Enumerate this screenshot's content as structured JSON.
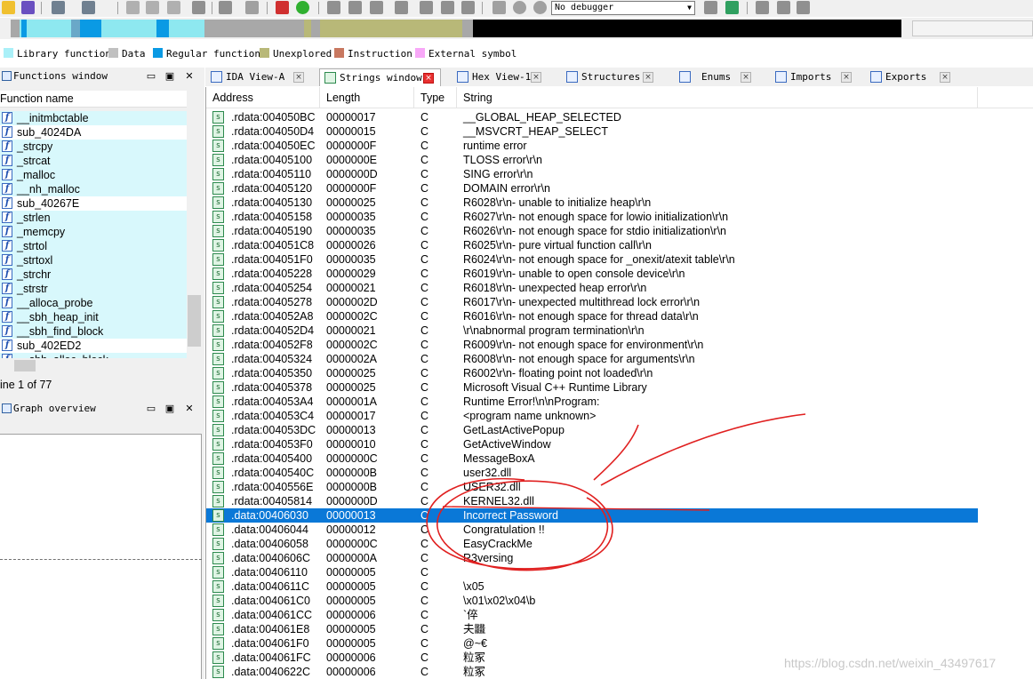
{
  "toolbar": {
    "debugger": "No debugger",
    "icons": [
      "open-icon",
      "save-icon",
      "back-icon",
      "forward-icon",
      "copy-icon",
      "paste-icon",
      "search-icon",
      "down-icon",
      "dump-icon",
      "warning-icon",
      "run-green-icon",
      "hex-icon",
      "data-icon",
      "plus-icon",
      "star-icon",
      "code-icon",
      "graph-icon",
      "cross-icon",
      "play-icon",
      "pause-icon",
      "stop-icon",
      "attach-icon",
      "detach-icon",
      "tools-icon"
    ]
  },
  "legend": {
    "items": [
      {
        "label": "Library function",
        "color": "#aaf0f8"
      },
      {
        "label": "Data",
        "color": "#c0c0c0"
      },
      {
        "label": "Regular function",
        "color": "#0a9ae4"
      },
      {
        "label": "Unexplored",
        "color": "#b8b878"
      },
      {
        "label": "Instruction",
        "color": "#c87860"
      },
      {
        "label": "External symbol",
        "color": "#f8a8f8"
      }
    ]
  },
  "functions_window": {
    "title": "Functions window",
    "column": "Function name",
    "items": [
      {
        "name": "__initmbctable",
        "lib": true
      },
      {
        "name": "sub_4024DA",
        "lib": false
      },
      {
        "name": "_strcpy",
        "lib": true
      },
      {
        "name": "_strcat",
        "lib": true
      },
      {
        "name": "_malloc",
        "lib": true
      },
      {
        "name": "__nh_malloc",
        "lib": true
      },
      {
        "name": "sub_40267E",
        "lib": false
      },
      {
        "name": "_strlen",
        "lib": true
      },
      {
        "name": "_memcpy",
        "lib": true
      },
      {
        "name": "_strtol",
        "lib": true
      },
      {
        "name": "_strtoxl",
        "lib": true
      },
      {
        "name": "_strchr",
        "lib": true
      },
      {
        "name": "_strstr",
        "lib": true
      },
      {
        "name": "__alloca_probe",
        "lib": true
      },
      {
        "name": "__sbh_heap_init",
        "lib": true
      },
      {
        "name": "__sbh_find_block",
        "lib": true
      },
      {
        "name": "sub_402ED2",
        "lib": false
      },
      {
        "name": "__sbh_alloc_block",
        "lib": true
      }
    ],
    "status": "ine 1 of 77"
  },
  "graph_overview": {
    "title": "Graph overview"
  },
  "tabs": [
    {
      "label": "IDA View-A",
      "active": false
    },
    {
      "label": "Strings window",
      "active": true
    },
    {
      "label": "Hex View-1",
      "active": false
    },
    {
      "label": "Structures",
      "active": false
    },
    {
      "label": "Enums",
      "active": false
    },
    {
      "label": "Imports",
      "active": false
    },
    {
      "label": "Exports",
      "active": false
    }
  ],
  "strings_window": {
    "columns": [
      "Address",
      "Length",
      "Type",
      "String"
    ],
    "rows": [
      {
        "address": ".rdata:004050BC",
        "length": "00000017",
        "type": "C",
        "string": "__GLOBAL_HEAP_SELECTED"
      },
      {
        "address": ".rdata:004050D4",
        "length": "00000015",
        "type": "C",
        "string": "__MSVCRT_HEAP_SELECT"
      },
      {
        "address": ".rdata:004050EC",
        "length": "0000000F",
        "type": "C",
        "string": "runtime error"
      },
      {
        "address": ".rdata:00405100",
        "length": "0000000E",
        "type": "C",
        "string": "TLOSS error\\r\\n"
      },
      {
        "address": ".rdata:00405110",
        "length": "0000000D",
        "type": "C",
        "string": "SING error\\r\\n"
      },
      {
        "address": ".rdata:00405120",
        "length": "0000000F",
        "type": "C",
        "string": "DOMAIN error\\r\\n"
      },
      {
        "address": ".rdata:00405130",
        "length": "00000025",
        "type": "C",
        "string": "R6028\\r\\n- unable to initialize heap\\r\\n"
      },
      {
        "address": ".rdata:00405158",
        "length": "00000035",
        "type": "C",
        "string": "R6027\\r\\n- not enough space for lowio initialization\\r\\n"
      },
      {
        "address": ".rdata:00405190",
        "length": "00000035",
        "type": "C",
        "string": "R6026\\r\\n- not enough space for stdio initialization\\r\\n"
      },
      {
        "address": ".rdata:004051C8",
        "length": "00000026",
        "type": "C",
        "string": "R6025\\r\\n- pure virtual function call\\r\\n"
      },
      {
        "address": ".rdata:004051F0",
        "length": "00000035",
        "type": "C",
        "string": "R6024\\r\\n- not enough space for _onexit/atexit table\\r\\n"
      },
      {
        "address": ".rdata:00405228",
        "length": "00000029",
        "type": "C",
        "string": "R6019\\r\\n- unable to open console device\\r\\n"
      },
      {
        "address": ".rdata:00405254",
        "length": "00000021",
        "type": "C",
        "string": "R6018\\r\\n- unexpected heap error\\r\\n"
      },
      {
        "address": ".rdata:00405278",
        "length": "0000002D",
        "type": "C",
        "string": "R6017\\r\\n- unexpected multithread lock error\\r\\n"
      },
      {
        "address": ".rdata:004052A8",
        "length": "0000002C",
        "type": "C",
        "string": "R6016\\r\\n- not enough space for thread data\\r\\n"
      },
      {
        "address": ".rdata:004052D4",
        "length": "00000021",
        "type": "C",
        "string": "\\r\\nabnormal program termination\\r\\n"
      },
      {
        "address": ".rdata:004052F8",
        "length": "0000002C",
        "type": "C",
        "string": "R6009\\r\\n- not enough space for environment\\r\\n"
      },
      {
        "address": ".rdata:00405324",
        "length": "0000002A",
        "type": "C",
        "string": "R6008\\r\\n- not enough space for arguments\\r\\n"
      },
      {
        "address": ".rdata:00405350",
        "length": "00000025",
        "type": "C",
        "string": "R6002\\r\\n- floating point not loaded\\r\\n"
      },
      {
        "address": ".rdata:00405378",
        "length": "00000025",
        "type": "C",
        "string": "Microsoft Visual C++ Runtime Library"
      },
      {
        "address": ".rdata:004053A4",
        "length": "0000001A",
        "type": "C",
        "string": "Runtime Error!\\n\\nProgram:"
      },
      {
        "address": ".rdata:004053C4",
        "length": "00000017",
        "type": "C",
        "string": "<program name unknown>"
      },
      {
        "address": ".rdata:004053DC",
        "length": "00000013",
        "type": "C",
        "string": "GetLastActivePopup"
      },
      {
        "address": ".rdata:004053F0",
        "length": "00000010",
        "type": "C",
        "string": "GetActiveWindow"
      },
      {
        "address": ".rdata:00405400",
        "length": "0000000C",
        "type": "C",
        "string": "MessageBoxA"
      },
      {
        "address": ".rdata:0040540C",
        "length": "0000000B",
        "type": "C",
        "string": "user32.dll"
      },
      {
        "address": ".rdata:0040556E",
        "length": "0000000B",
        "type": "C",
        "string": "USER32.dll"
      },
      {
        "address": ".rdata:00405814",
        "length": "0000000D",
        "type": "C",
        "string": "KERNEL32.dll"
      },
      {
        "address": ".data:00406030",
        "length": "00000013",
        "type": "C",
        "string": "Incorrect Password",
        "selected": true
      },
      {
        "address": ".data:00406044",
        "length": "00000012",
        "type": "C",
        "string": "Congratulation !!"
      },
      {
        "address": ".data:00406058",
        "length": "0000000C",
        "type": "C",
        "string": "EasyCrackMe"
      },
      {
        "address": ".data:0040606C",
        "length": "0000000A",
        "type": "C",
        "string": "R3versing"
      },
      {
        "address": ".data:00406110",
        "length": "00000005",
        "type": "C",
        "string": ""
      },
      {
        "address": ".data:0040611C",
        "length": "00000005",
        "type": "C",
        "string": "\\x05"
      },
      {
        "address": ".data:004061C0",
        "length": "00000005",
        "type": "C",
        "string": "\\x01\\x02\\x04\\b"
      },
      {
        "address": ".data:004061CC",
        "length": "00000006",
        "type": "C",
        "string": "`倅"
      },
      {
        "address": ".data:004061E8",
        "length": "00000005",
        "type": "C",
        "string": "夫𪚥"
      },
      {
        "address": ".data:004061F0",
        "length": "00000005",
        "type": "C",
        "string": "@~€"
      },
      {
        "address": ".data:004061FC",
        "length": "00000006",
        "type": "C",
        "string": "粒冢"
      },
      {
        "address": ".data:0040622C",
        "length": "00000006",
        "type": "C",
        "string": "粒冢"
      }
    ]
  },
  "watermark": "https://blog.csdn.net/weixin_43497617"
}
